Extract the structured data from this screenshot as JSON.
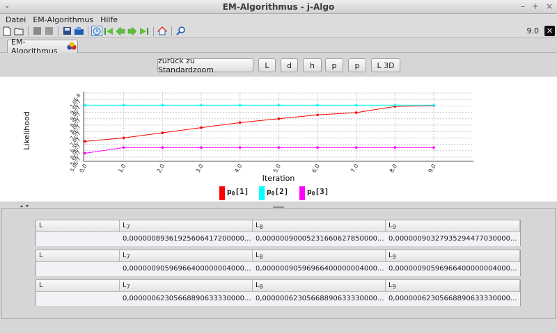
{
  "window": {
    "title": "EM-Algorithmus  - j-Algo",
    "controls": [
      "⌄",
      "–",
      "+",
      "×"
    ]
  },
  "menu": {
    "items": [
      "Datei",
      "EM-Algorithmus",
      "Hilfe"
    ]
  },
  "toolbar": {
    "zoom_value": "9.0",
    "close_label": "✕"
  },
  "tab": {
    "label": "EM-Algorithmus"
  },
  "buttons": {
    "reset_zoom": "zurück zu Standardzoom",
    "L": "L",
    "d": "d",
    "h": "h",
    "p1": "p",
    "p2": "p",
    "L3D": "L 3D"
  },
  "chart_data": {
    "type": "line",
    "xlabel": "Iteration",
    "ylabel": "Likelihood",
    "x": [
      0,
      1,
      2,
      3,
      4,
      5,
      6,
      7,
      8,
      9
    ],
    "x_tick_labels": [
      "0.0",
      "1.0",
      "2.0",
      "3.0",
      "4.0",
      "5.0",
      "6.0",
      "7.0",
      "8.0",
      "9.0"
    ],
    "y_tick_labels": [
      "5.0E-7",
      "5.5E-7",
      "6.0E-7",
      "6.5E-7",
      "7.0E-7",
      "7.5E-7",
      "8.0E-7",
      "8.5E-7",
      "9.0E-7",
      "9.5E-7",
      "1.0E-6"
    ],
    "ylim": [
      5e-07,
      1e-06
    ],
    "grid": true,
    "legend_position": "bottom",
    "series": [
      {
        "name": "p0[1]",
        "color": "#ff0000",
        "values": [
          6.23e-07,
          6.5e-07,
          6.9e-07,
          7.3e-07,
          7.7e-07,
          8e-07,
          8.3e-07,
          8.48e-07,
          8.96e-07,
          9.03e-07
        ]
      },
      {
        "name": "p0[2]",
        "color": "#00ffff",
        "values": [
          9.06e-07,
          9.06e-07,
          9.06e-07,
          9.06e-07,
          9.06e-07,
          9.06e-07,
          9.06e-07,
          9.06e-07,
          9.06e-07,
          9.06e-07
        ]
      },
      {
        "name": "p0[3]",
        "color": "#ff00ff",
        "values": [
          5.3e-07,
          5.75e-07,
          5.75e-07,
          5.75e-07,
          5.75e-07,
          5.75e-07,
          5.75e-07,
          5.75e-07,
          5.75e-07,
          5.75e-07
        ]
      }
    ]
  },
  "legend": [
    {
      "base": "p",
      "sub": "0",
      "idx": "[1]",
      "color": "#ff0000"
    },
    {
      "base": "p",
      "sub": "0",
      "idx": "[2]",
      "color": "#00ffff"
    },
    {
      "base": "p",
      "sub": "0",
      "idx": "[3]",
      "color": "#ff00ff"
    }
  ],
  "tables": [
    {
      "headers": [
        {
          "base": "L",
          "sub": ""
        },
        {
          "base": "L",
          "sub": "7"
        },
        {
          "base": "L",
          "sub": "8"
        },
        {
          "base": "L",
          "sub": "9"
        }
      ],
      "values": [
        "",
        "0,00000089361925606417200000...",
        "0,00000090005231660627850000...",
        "0,00000090327935294477030000..."
      ]
    },
    {
      "headers": [
        {
          "base": "L",
          "sub": ""
        },
        {
          "base": "L",
          "sub": "7"
        },
        {
          "base": "L",
          "sub": "8"
        },
        {
          "base": "L",
          "sub": "9"
        }
      ],
      "values": [
        "",
        "0,00000090596966400000004000...",
        "0,00000090596966400000004000...",
        "0,00000090596966400000004000..."
      ]
    },
    {
      "headers": [
        {
          "base": "L",
          "sub": ""
        },
        {
          "base": "L",
          "sub": "7"
        },
        {
          "base": "L",
          "sub": "8"
        },
        {
          "base": "L",
          "sub": "9"
        }
      ],
      "values": [
        "",
        "0,00000062305668890633330000...",
        "0,00000062305668890633330000...",
        "0,00000062305668890633330000..."
      ]
    }
  ]
}
